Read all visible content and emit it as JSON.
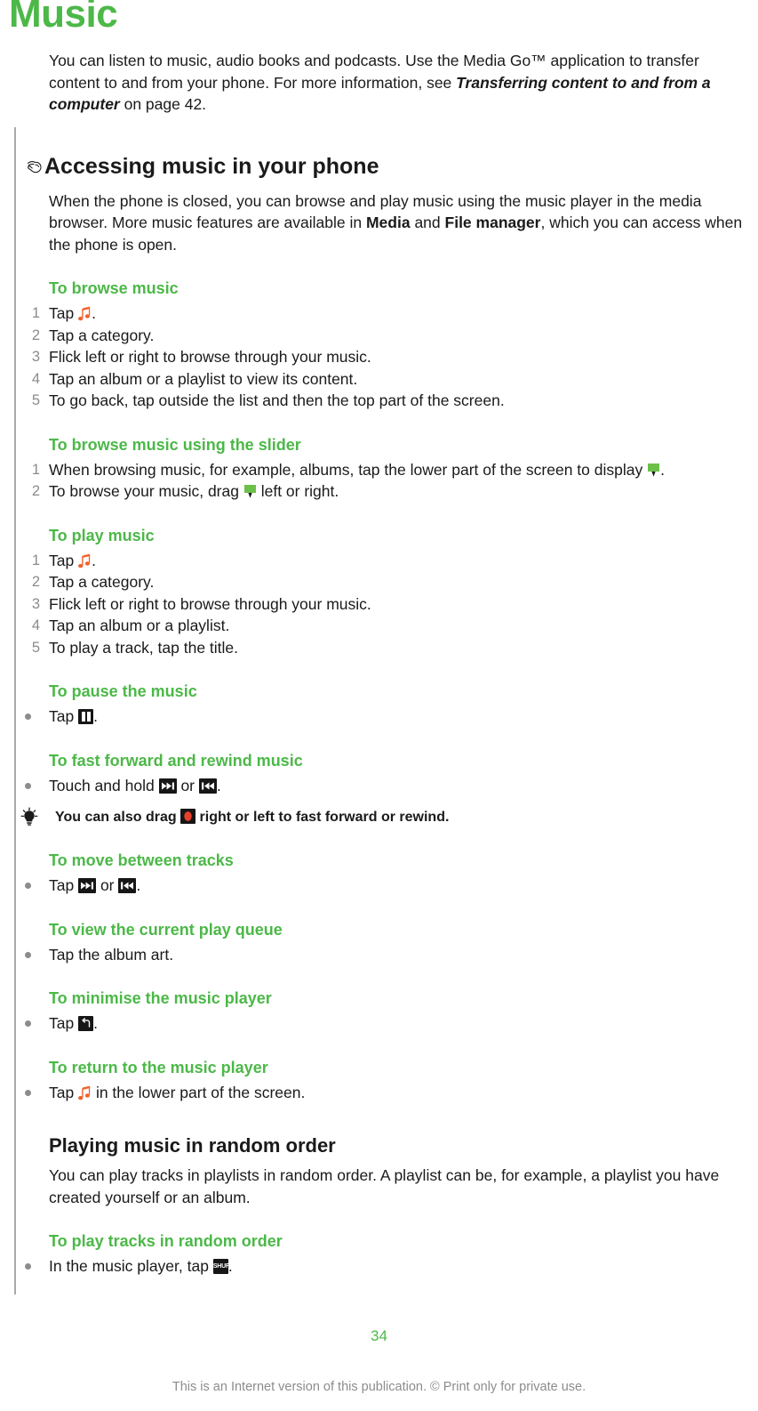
{
  "document": {
    "chapter_title": "Music",
    "page_number": "34",
    "footer_note": "This is an Internet version of this publication. © Print only for private use.",
    "accent_color": "#4cb848",
    "text_color": "#1a1a1a",
    "muted_color": "#8c8c8c"
  },
  "intro": {
    "part1": "You can listen to music, audio books and podcasts. Use the Media Go™ application to transfer content to and from your phone. For more information, see ",
    "italic_ref": "Transferring content to and from a computer",
    "part2": " on page 42."
  },
  "section": {
    "heading": "Accessing music in your phone",
    "icon": "pointing-hand-icon",
    "paragraph_pre": "When the phone is closed, you can browse and play music using the music player in the media browser. More music features are available in ",
    "bold1": "Media",
    "paragraph_mid": " and ",
    "bold2": "File manager",
    "paragraph_post": ", which you can access when the phone is open."
  },
  "procedures": [
    {
      "title": "To browse music",
      "type": "ordered",
      "steps": [
        {
          "pre": "Tap ",
          "icon": "music-note-icon",
          "post": "."
        },
        {
          "pre": "Tap a category.",
          "icon": null,
          "post": ""
        },
        {
          "pre": "Flick left or right to browse through your music.",
          "icon": null,
          "post": ""
        },
        {
          "pre": "Tap an album or a playlist to view its content.",
          "icon": null,
          "post": ""
        },
        {
          "pre": "To go back, tap outside the list and then the top part of the screen.",
          "icon": null,
          "post": ""
        }
      ]
    },
    {
      "title": "To browse music using the slider",
      "type": "ordered",
      "steps": [
        {
          "pre": "When browsing music, for example, albums, tap the lower part of the screen to display ",
          "icon": "slider-marker-icon",
          "post": "."
        },
        {
          "pre": "To browse your music, drag ",
          "icon": "slider-marker-icon",
          "post": " left or right."
        }
      ]
    },
    {
      "title": "To play music",
      "type": "ordered",
      "steps": [
        {
          "pre": "Tap ",
          "icon": "music-note-icon",
          "post": "."
        },
        {
          "pre": "Tap a category.",
          "icon": null,
          "post": ""
        },
        {
          "pre": "Flick left or right to browse through your music.",
          "icon": null,
          "post": ""
        },
        {
          "pre": "Tap an album or a playlist.",
          "icon": null,
          "post": ""
        },
        {
          "pre": "To play a track, tap the title.",
          "icon": null,
          "post": ""
        }
      ]
    },
    {
      "title": "To pause the music",
      "type": "bullet",
      "steps": [
        {
          "pre": "Tap ",
          "icon": "pause-icon",
          "post": "."
        }
      ]
    },
    {
      "title": "To fast forward and rewind music",
      "type": "bullet",
      "steps": [
        {
          "pre": "Touch and hold ",
          "icon": "next-track-icon",
          "mid": " or ",
          "icon2": "previous-track-icon",
          "post": "."
        }
      ],
      "tip": {
        "icon": "lightbulb-icon",
        "pre": "You can also drag ",
        "tip_icon": "drag-handle-icon",
        "post": " right or left to fast forward or rewind."
      }
    },
    {
      "title": "To move between tracks",
      "type": "bullet",
      "steps": [
        {
          "pre": "Tap ",
          "icon": "next-track-icon",
          "mid": " or ",
          "icon2": "previous-track-icon",
          "post": "."
        }
      ]
    },
    {
      "title": "To view the current play queue",
      "type": "bullet",
      "steps": [
        {
          "pre": "Tap the album art.",
          "icon": null,
          "post": ""
        }
      ]
    },
    {
      "title": "To minimise the music player",
      "type": "bullet",
      "steps": [
        {
          "pre": "Tap ",
          "icon": "back-arrow-icon",
          "post": "."
        }
      ]
    },
    {
      "title": "To return to the music player",
      "type": "bullet",
      "steps": [
        {
          "pre": "Tap ",
          "icon": "music-note-icon",
          "post": " in the lower part of the screen."
        }
      ]
    }
  ],
  "random_section": {
    "heading": "Playing music in random order",
    "paragraph": "You can play tracks in playlists in random order. A playlist can be, for example, a playlist you have created yourself or an album.",
    "procedure": {
      "title": "To play tracks in random order",
      "step_pre": "In the music player, tap ",
      "step_icon": "shuffle-icon",
      "step_post": "."
    }
  },
  "step_numbers": [
    "1",
    "2",
    "3",
    "4",
    "5"
  ],
  "icon_colors": {
    "music_note": "#f06a2a",
    "marker_green": "#6cc04a",
    "drag_handle_red": "#e8402a",
    "icon_box_bg": "#161616"
  }
}
